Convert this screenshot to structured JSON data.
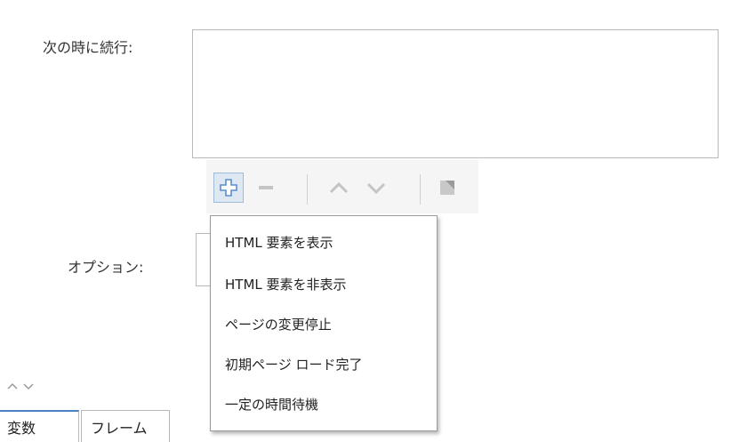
{
  "form": {
    "continue_label": "次の時に続行:",
    "options_label": "オプション:"
  },
  "toolbar": {
    "add_icon": "plus-icon",
    "remove_icon": "minus-icon",
    "up_icon": "chevron-up-icon",
    "down_icon": "chevron-down-icon",
    "delete_icon": "delete-icon",
    "accent_color": "#4a7fc0"
  },
  "add_menu": {
    "items": [
      {
        "label": "HTML 要素を表示"
      },
      {
        "label": "HTML 要素を非表示"
      },
      {
        "label": "ページの変更停止"
      },
      {
        "label": "初期ページ ロード完了"
      },
      {
        "label": "一定の時間待機"
      }
    ]
  },
  "bottom_tabs": [
    {
      "label": "変数",
      "active": true
    },
    {
      "label": "フレーム",
      "active": false
    }
  ]
}
